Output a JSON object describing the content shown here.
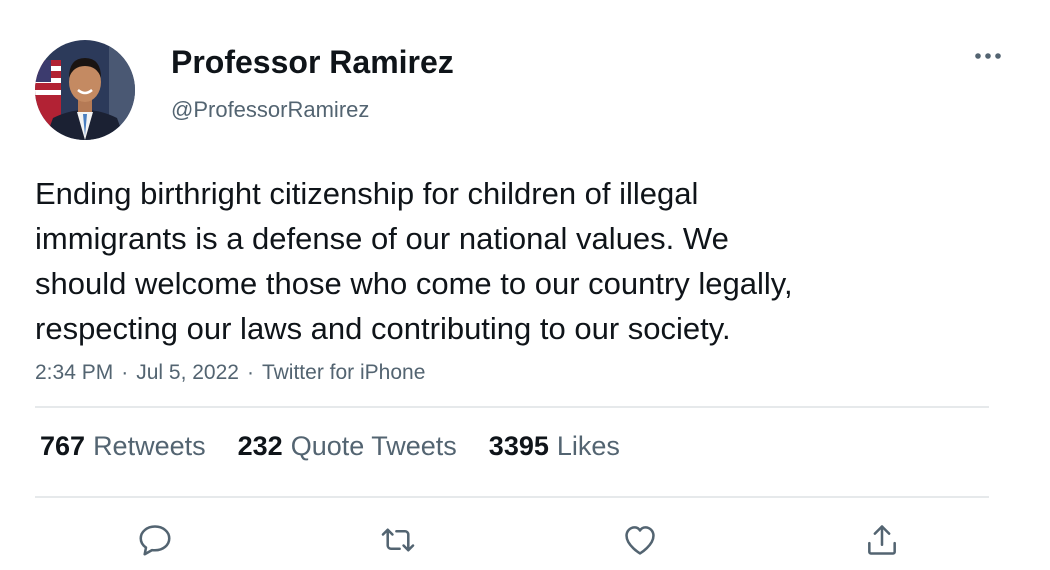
{
  "tweet": {
    "author": {
      "display_name": "Professor Ramirez",
      "handle": "@ProfessorRamirez"
    },
    "text": "Ending birthright citizenship for children of illegal\nimmigrants is a defense of our national values. We\nshould welcome those who come to our country legally,\nrespecting our laws and contributing to our society.",
    "meta": {
      "time": "2:34 PM",
      "date": "Jul 5, 2022",
      "source": "Twitter for iPhone",
      "separator": "·"
    },
    "stats": {
      "retweets_count": "767",
      "retweets_label": "Retweets",
      "quotes_count": "232",
      "quotes_label": "Quote Tweets",
      "likes_count": "3395",
      "likes_label": "Likes"
    }
  },
  "icons": {
    "more": "more-horizontal-icon",
    "reply": "reply-bubble-icon",
    "retweet": "retweet-icon",
    "like": "heart-icon",
    "share": "share-upload-icon"
  },
  "colors": {
    "text_primary": "#0f1419",
    "text_secondary": "#536471",
    "divider": "#e6e9eb",
    "icon": "#536471"
  }
}
